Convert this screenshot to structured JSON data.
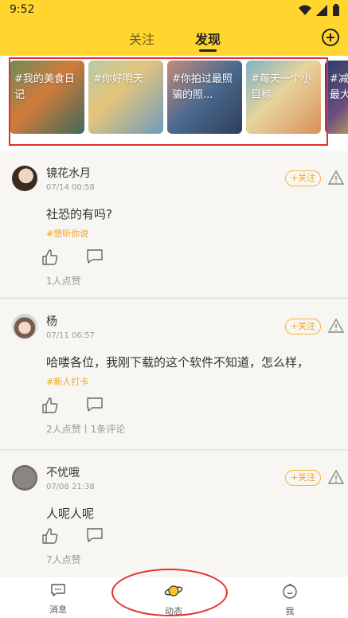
{
  "status_bar": {
    "time": "9:52"
  },
  "header": {
    "tabs": [
      {
        "label": "关注"
      },
      {
        "label": "发现"
      }
    ]
  },
  "topics": [
    {
      "label": "#我的美食日记"
    },
    {
      "label": "#你好明天"
    },
    {
      "label": "#你拍过最照骗的照..."
    },
    {
      "label": "#每天一个小目标"
    },
    {
      "label": "#减最大"
    }
  ],
  "follow_label": "+关注",
  "posts": [
    {
      "name": "镜花水月",
      "date": "07/14 00:58",
      "content": "社恐的有吗?",
      "tag": "#想听你说",
      "stats": "1人点赞"
    },
    {
      "name": "杨",
      "date": "07/11 06:57",
      "content": "哈喽各位，我刚下载的这个软件不知道，怎么样，",
      "tag": "#新人打卡",
      "stats": "2人点赞丨1条评论"
    },
    {
      "name": "不忧哦",
      "date": "07/08 21:38",
      "content": "人呢人呢",
      "tag": "",
      "stats": "7人点赞"
    }
  ],
  "bottom_nav": [
    {
      "label": "消息"
    },
    {
      "label": "动态"
    },
    {
      "label": "我"
    }
  ],
  "colors": {
    "brand_yellow": "#ffd52e",
    "accent_orange": "#f0a51f",
    "annotation_red": "#e0312f"
  }
}
